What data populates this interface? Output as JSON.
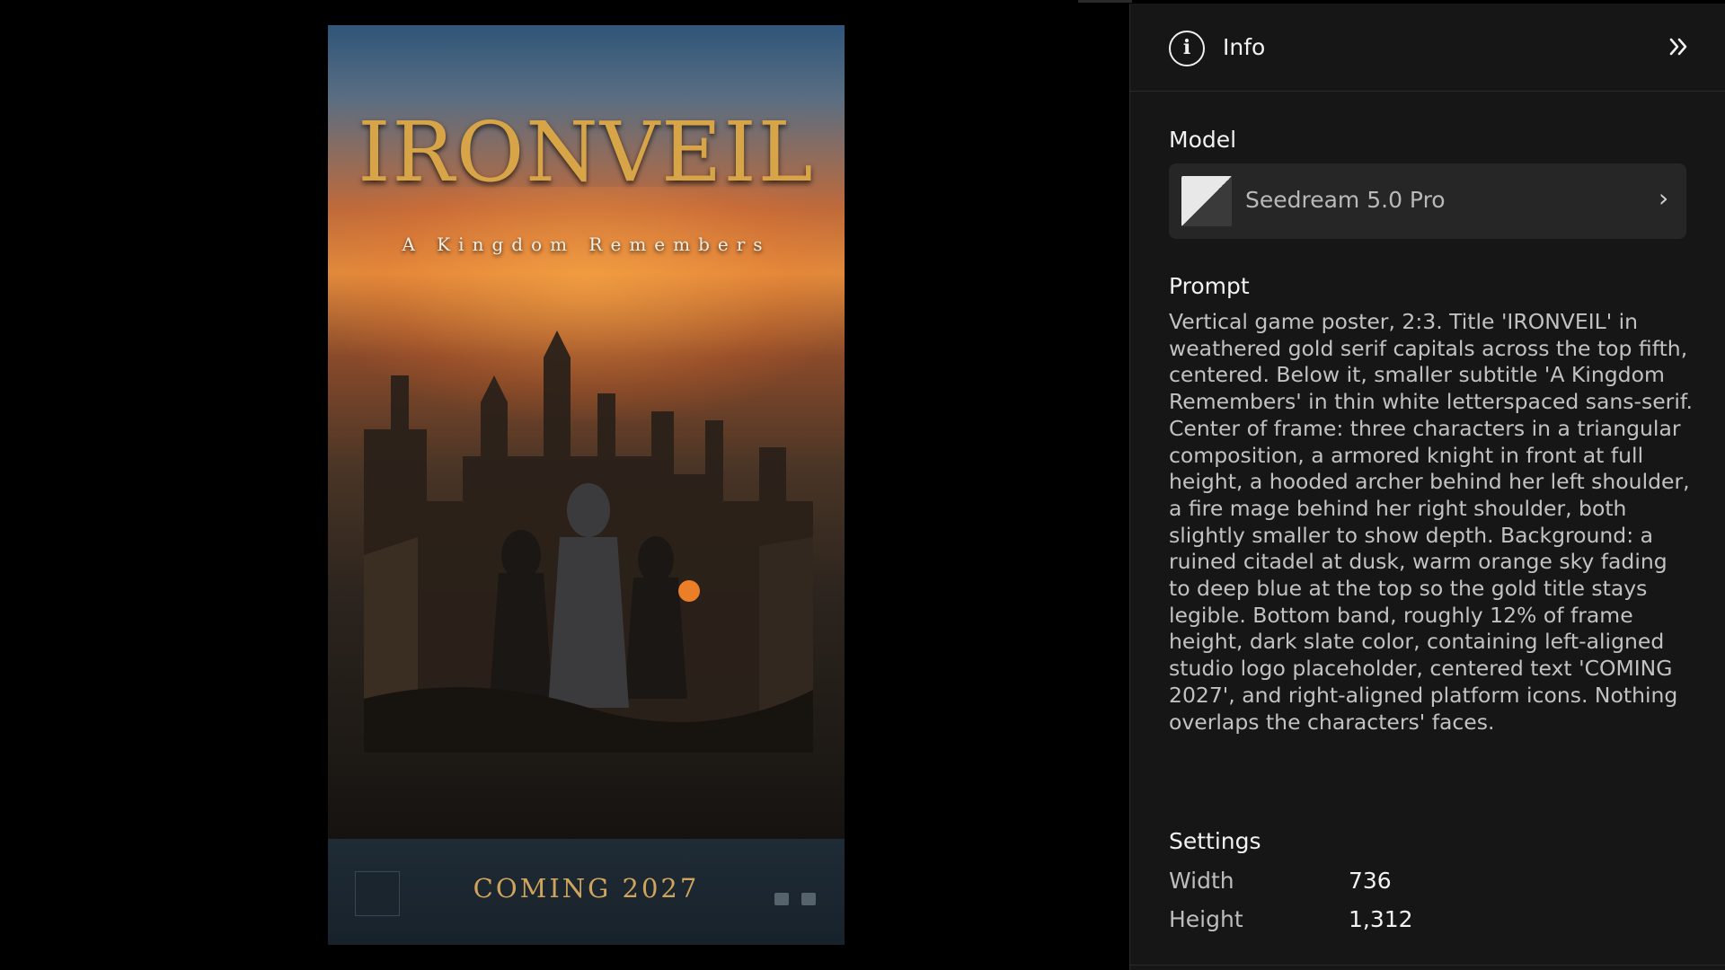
{
  "poster": {
    "title": "IRONVEIL",
    "subtitle": "A Kingdom Remembers",
    "band_text": "COMING 2027"
  },
  "panel": {
    "title": "Info",
    "info_icon": "info-circle-icon",
    "collapse_icon": "double-chevron-right-icon",
    "model_label": "Model",
    "model_name": "Seedream 5.0 Pro",
    "model_chevron_icon": "chevron-right-icon",
    "prompt_label": "Prompt",
    "prompt_text": "Vertical game poster, 2:3. Title 'IRONVEIL' in weathered gold serif capitals across the top fifth, centered. Below it, smaller subtitle 'A Kingdom Remembers' in thin white letterspaced sans-serif. Center of frame: three characters in a triangular composition, a armored knight in front at full height, a hooded archer behind her left shoulder, a fire mage behind her right shoulder, both slightly smaller to show depth. Background: a ruined citadel at dusk, warm orange sky fading to deep blue at the top so the gold title stays legible. Bottom band, roughly 12% of frame height, dark slate color, containing left-aligned studio logo placeholder, centered text 'COMING 2027', and right-aligned platform icons. Nothing overlaps the characters' faces.",
    "settings_label": "Settings",
    "settings": [
      {
        "key": "Width",
        "value": "736"
      },
      {
        "key": "Height",
        "value": "1,312"
      }
    ]
  },
  "colors": {
    "panel_bg": "#161616",
    "card_bg": "#262626",
    "poster_gold": "#d7a548"
  }
}
